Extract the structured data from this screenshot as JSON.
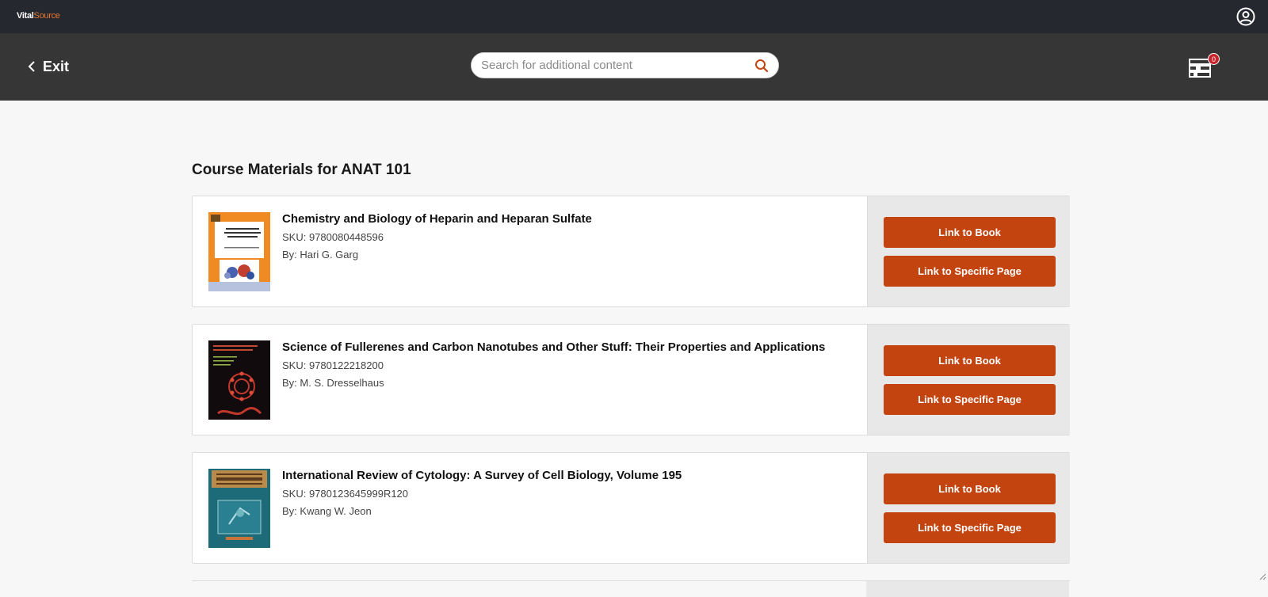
{
  "brand": {
    "part1": "Vital",
    "part2": "Source"
  },
  "header": {
    "exit_label": "Exit",
    "search_placeholder": "Search for additional content",
    "search_value": "",
    "cart_count": "0"
  },
  "icons": {
    "account": "account-circle-icon",
    "back": "chevron-left-icon",
    "search": "search-icon",
    "cart": "book-cart-icon"
  },
  "colors": {
    "topbar": "#262830",
    "header": "#363636",
    "accent_button": "#c4440f",
    "brand_orange": "#e8772e",
    "badge": "#c8242b"
  },
  "main": {
    "title": "Course Materials for ANAT 101",
    "books": [
      {
        "title": "Chemistry and Biology of Heparin and Heparan Sulfate",
        "sku": "SKU: 9780080448596",
        "author": "By: Hari G. Garg",
        "link_book_label": "Link to Book",
        "link_page_label": "Link to Specific Page"
      },
      {
        "title": "Science of Fullerenes and Carbon Nanotubes and Other Stuff: Their Properties and Applications",
        "sku": "SKU: 9780122218200",
        "author": "By: M. S. Dresselhaus",
        "link_book_label": "Link to Book",
        "link_page_label": "Link to Specific Page"
      },
      {
        "title": "International Review of Cytology: A Survey of Cell Biology, Volume 195",
        "sku": "SKU: 9780123645999R120",
        "author": "By: Kwang W. Jeon",
        "link_book_label": "Link to Book",
        "link_page_label": "Link to Specific Page"
      }
    ]
  }
}
